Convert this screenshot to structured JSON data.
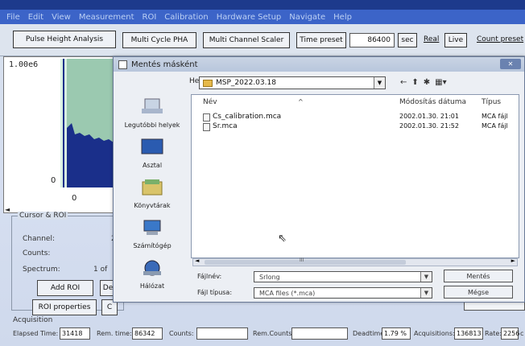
{
  "colors": {
    "menubar": "#3c64c8",
    "dialog_bg": "#eceff4",
    "spectrum_fill": "#9bc9b0",
    "spectrum_bars": "#1a2f8a"
  },
  "menu": [
    "File",
    "Edit",
    "View",
    "Measurement",
    "ROI",
    "Calibration",
    "Hardware Setup",
    "Navigate",
    "Help"
  ],
  "toolbar": {
    "tab_pha": "Pulse Height Analysis",
    "multi_cycle": "Multi Cycle PHA",
    "multi_channel": "Multi Channel Scaler",
    "time_preset_label": "Time preset",
    "time_preset_value": "86400",
    "sec_label": "sec",
    "real_label": "Real",
    "live_label": "Live",
    "count_preset_label": "Count preset"
  },
  "spectrum": {
    "y_top": "1.00e6",
    "y_zero": "0",
    "x_zero": "0",
    "scroll_left": "◄"
  },
  "roi": {
    "title": "Cursor & ROI",
    "channel_label": "Channel:",
    "channel_value": "2",
    "counts_label": "Counts:",
    "spectrum_label": "Spectrum:",
    "spectrum_value": "1 of",
    "add_roi": "Add ROI",
    "del_partial": "De",
    "roi_properties": "ROI properties",
    "c_partial": "C"
  },
  "acquisition": {
    "title": "Acquisition",
    "elapsed_label": "Elapsed Time:",
    "elapsed_value": "31418",
    "rem_time_label": "Rem. time:",
    "rem_time_value": "86342",
    "counts_label": "Counts:",
    "counts_value": "",
    "rem_counts_label": "Rem.Counts:",
    "rem_counts_value": "",
    "deadtime_label": "Deadtime:",
    "deadtime_value": "1.79 %",
    "acquisitions_label": "Acquisitions:",
    "acquisitions_value": "136813",
    "rate_label": "Rate:",
    "rate_value": "2256",
    "rate_unit": "c"
  },
  "dialog": {
    "title": "Mentés másként",
    "close": "✕",
    "hely_label": "Hely:",
    "hely_value": "MSP_2022.03.18",
    "places": [
      {
        "label": "Legutóbbi helyek"
      },
      {
        "label": "Asztal"
      },
      {
        "label": "Könyvtárak"
      },
      {
        "label": "Számítógép"
      },
      {
        "label": "Hálózat"
      }
    ],
    "columns": {
      "name": "Név",
      "date": "Módosítás dátuma",
      "type": "Típus"
    },
    "files": [
      {
        "name": "Cs_calibration.mca",
        "date": "2002.01.30. 21:01",
        "type": "MCA fájl"
      },
      {
        "name": "Sr.mca",
        "date": "2002.01.30. 21:52",
        "type": "MCA fájl"
      }
    ],
    "scroll_mark": "III",
    "filename_label": "Fájlnév:",
    "filename_value": "Srlong",
    "filetype_label": "Fájl típusa:",
    "filetype_value": "MCA files (*.mca)",
    "save_button": "Mentés",
    "cancel_button": "Mégse"
  }
}
